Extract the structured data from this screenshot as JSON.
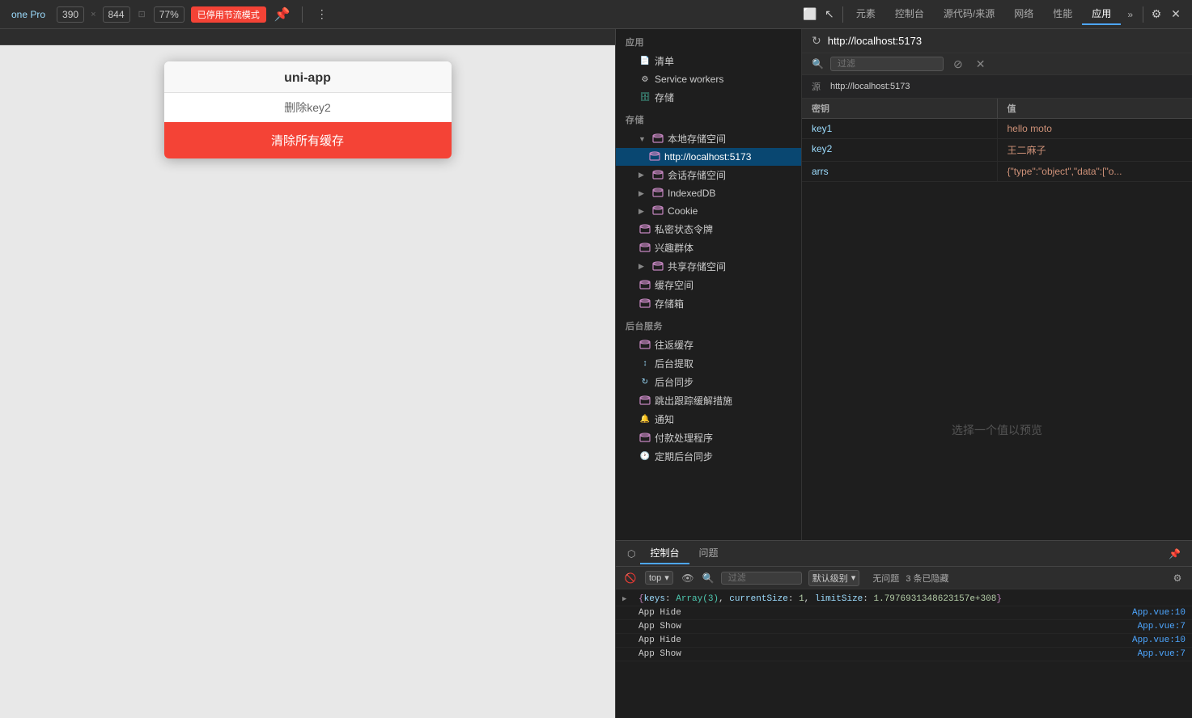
{
  "toolbar": {
    "device_label": "one Pro",
    "width_label": "390",
    "height_label": "844",
    "zoom_label": "77%",
    "mode_badge": "已停用节流模式",
    "more_icon": "⋮",
    "toggle_icon": "⬜",
    "tabs": [
      {
        "id": "elements",
        "label": "元素"
      },
      {
        "id": "console",
        "label": "控制台"
      },
      {
        "id": "source",
        "label": "源代码/来源"
      },
      {
        "id": "network",
        "label": "网络"
      },
      {
        "id": "performance",
        "label": "性能"
      },
      {
        "id": "app",
        "label": "应用",
        "active": true
      },
      {
        "id": "more",
        "label": "»"
      }
    ],
    "settings_icon": "⚙",
    "close_icon": "✕"
  },
  "devtools": {
    "url_bar": {
      "url": "http://localhost:5173"
    },
    "filter": {
      "label": "过滤",
      "placeholder": "过滤"
    },
    "sections": {
      "app": {
        "label": "应用",
        "items": [
          {
            "id": "manifest",
            "label": "清单",
            "icon": "file"
          },
          {
            "id": "service-workers",
            "label": "Service workers",
            "icon": "gear"
          }
        ],
        "storage_item": {
          "label": "存储",
          "icon": "db"
        }
      },
      "storage": {
        "label": "存储",
        "items": [
          {
            "id": "local-storage",
            "label": "本地存储空间",
            "icon": "db",
            "expanded": true,
            "children": [
              {
                "id": "localhost",
                "label": "http://localhost:5173",
                "icon": "db",
                "selected": true
              }
            ]
          },
          {
            "id": "session-storage",
            "label": "会话存储空间",
            "icon": "db",
            "expanded": false
          },
          {
            "id": "indexeddb",
            "label": "IndexedDB",
            "icon": "db",
            "expanded": false
          },
          {
            "id": "cookie",
            "label": "Cookie",
            "icon": "db",
            "expanded": false
          },
          {
            "id": "private-token",
            "label": "私密状态令牌",
            "icon": "db"
          },
          {
            "id": "interest-groups",
            "label": "兴趣群体",
            "icon": "db"
          },
          {
            "id": "shared-storage",
            "label": "共享存储空间",
            "icon": "db",
            "expanded": false
          },
          {
            "id": "cache-storage",
            "label": "缓存空间",
            "icon": "db"
          },
          {
            "id": "storage-box",
            "label": "存储箱",
            "icon": "db"
          }
        ]
      },
      "background": {
        "label": "后台服务",
        "items": [
          {
            "id": "back-cache",
            "label": "往返缓存",
            "icon": "db"
          },
          {
            "id": "background-fetch",
            "label": "后台提取",
            "icon": "arrows"
          },
          {
            "id": "background-sync",
            "label": "后台同步",
            "icon": "sync"
          },
          {
            "id": "bounce-tracking",
            "label": "跳出跟踪缓解措施",
            "icon": "db"
          },
          {
            "id": "notification",
            "label": "通知",
            "icon": "bell"
          },
          {
            "id": "payment",
            "label": "付款处理程序",
            "icon": "db"
          },
          {
            "id": "periodic-sync",
            "label": "定期后台同步",
            "icon": "clock"
          }
        ]
      }
    },
    "table": {
      "source_label": "源",
      "source_value": "http://localhost:5173",
      "columns": [
        "密钥",
        "值"
      ],
      "rows": [
        {
          "key": "key1",
          "value": "hello moto"
        },
        {
          "key": "key2",
          "value": "王二麻子"
        },
        {
          "key": "arrs",
          "value": "{\"type\":\"object\",\"data\":[\"o..."
        }
      ]
    },
    "preview": {
      "placeholder": "选择一个值以预览"
    }
  },
  "phone": {
    "app_title": "uni-app",
    "delete_btn": "删除key2",
    "clear_btn": "清除所有缓存"
  },
  "console_panel": {
    "tabs": [
      {
        "id": "console",
        "label": "控制台",
        "active": true
      },
      {
        "id": "issues",
        "label": "问题"
      }
    ],
    "toolbar": {
      "ban_icon": "🚫",
      "top_dropdown": "top",
      "eye_icon": "👁",
      "filter_label": "过滤",
      "filter_placeholder": "过滤",
      "level_label": "默认级别",
      "no_issues": "无问题",
      "hidden_count": "3 条已隐藏"
    },
    "logs": [
      {
        "type": "object",
        "text": "▶ {keys: Array(3), currentSize: 1, limitSize: 1.7976931348623157e+308}",
        "source": null
      },
      {
        "type": "info",
        "label": "App Hide",
        "text": "App Hide",
        "source": "App.vue:10"
      },
      {
        "type": "info",
        "label": "App Show",
        "text": "App Show",
        "source": "App.vue:7"
      },
      {
        "type": "info",
        "label": "App Hide",
        "text": "App Hide",
        "source": "App.vue:10"
      },
      {
        "type": "info",
        "label": "App Show",
        "text": "App Show",
        "source": "App.vue:7"
      }
    ]
  }
}
